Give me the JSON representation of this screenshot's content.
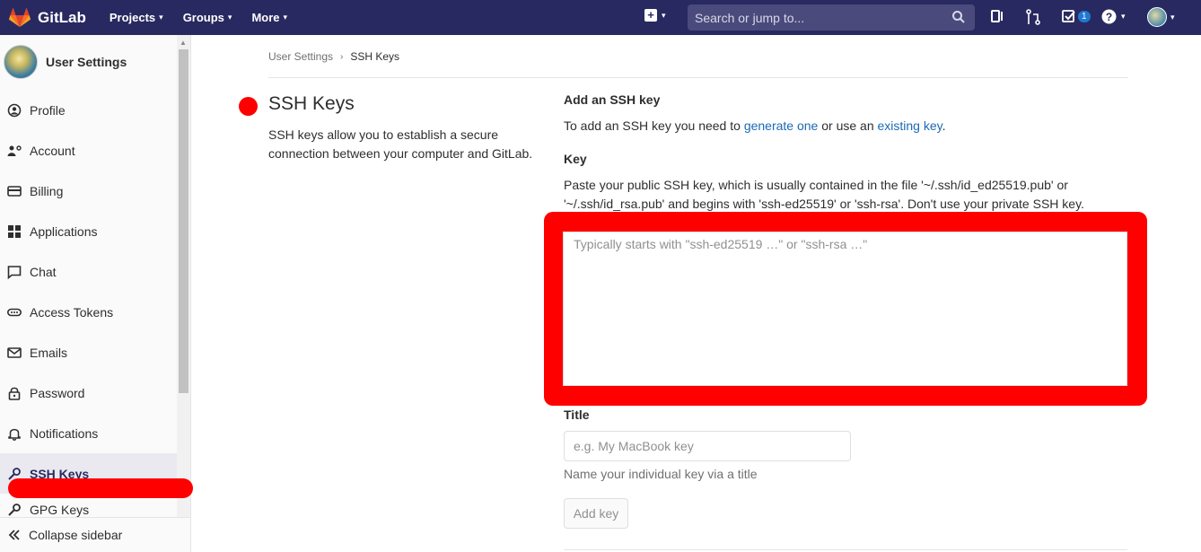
{
  "navbar": {
    "brand": "GitLab",
    "items": [
      "Projects",
      "Groups",
      "More"
    ],
    "search_placeholder": "Search or jump to...",
    "todo_count": "1"
  },
  "sidebar": {
    "title": "User Settings",
    "items": [
      {
        "label": "Profile",
        "icon": "profile-icon"
      },
      {
        "label": "Account",
        "icon": "account-icon"
      },
      {
        "label": "Billing",
        "icon": "billing-icon"
      },
      {
        "label": "Applications",
        "icon": "applications-icon"
      },
      {
        "label": "Chat",
        "icon": "chat-icon"
      },
      {
        "label": "Access Tokens",
        "icon": "access-tokens-icon"
      },
      {
        "label": "Emails",
        "icon": "emails-icon"
      },
      {
        "label": "Password",
        "icon": "password-icon"
      },
      {
        "label": "Notifications",
        "icon": "notifications-icon"
      },
      {
        "label": "SSH Keys",
        "icon": "key-icon",
        "active": true
      },
      {
        "label": "GPG Keys",
        "icon": "key-icon"
      }
    ],
    "collapse_label": "Collapse sidebar"
  },
  "breadcrumb": {
    "parent": "User Settings",
    "current": "SSH Keys"
  },
  "section": {
    "title": "SSH Keys",
    "description": "SSH keys allow you to establish a secure connection between your computer and GitLab."
  },
  "form": {
    "add_heading": "Add an SSH key",
    "add_text_1": "To add an SSH key you need to ",
    "link_generate": "generate one",
    "add_text_2": " or use an ",
    "link_existing": "existing key",
    "add_text_3": ".",
    "key_label": "Key",
    "key_help": "Paste your public SSH key, which is usually contained in the file '~/.ssh/id_ed25519.pub' or '~/.ssh/id_rsa.pub' and begins with 'ssh-ed25519' or 'ssh-rsa'. Don't use your private SSH key.",
    "key_placeholder": "Typically starts with \"ssh-ed25519 …\" or \"ssh-rsa …\"",
    "title_label": "Title",
    "title_placeholder": "e.g. My MacBook key",
    "title_hint": "Name your individual key via a title",
    "add_button": "Add key"
  },
  "colors": {
    "navbar": "#292961",
    "annotation": "#ff0000",
    "link": "#1b69b6"
  }
}
